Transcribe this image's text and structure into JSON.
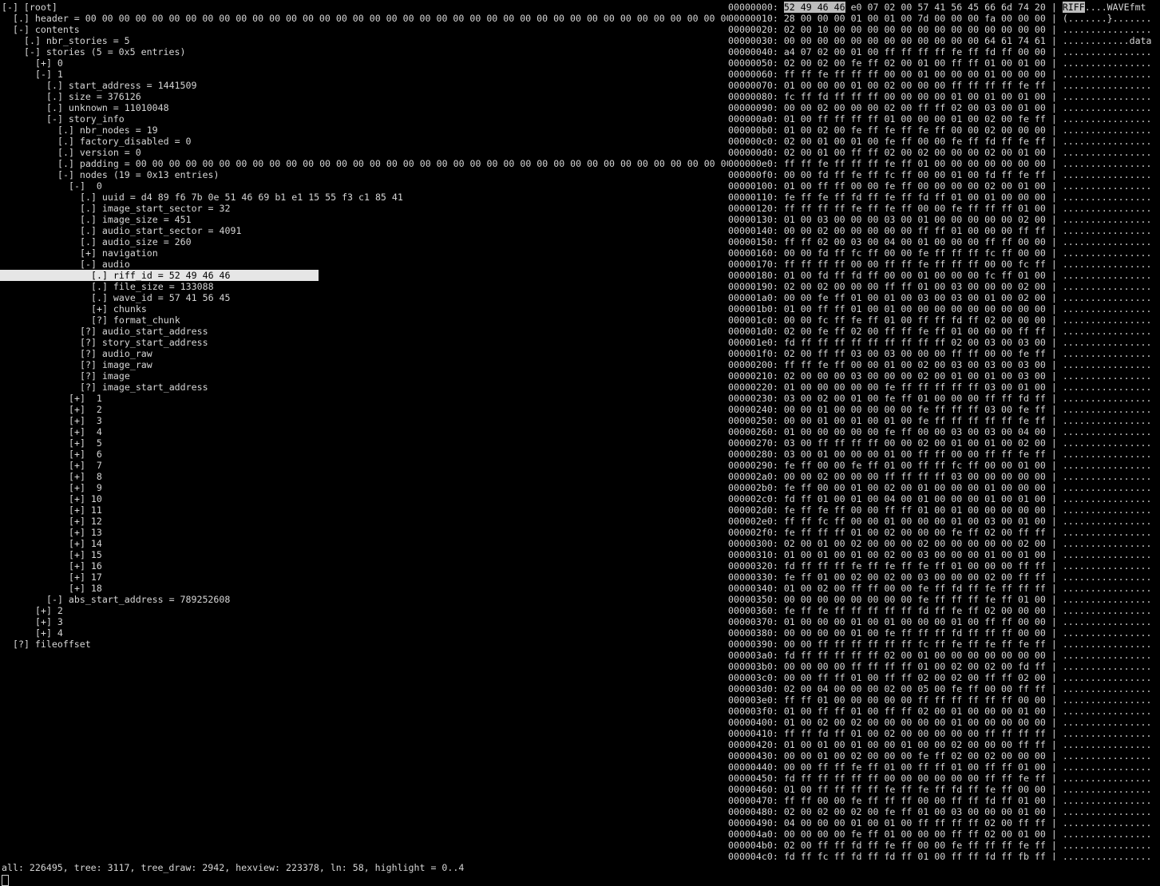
{
  "tree": {
    "selected_index": 24,
    "lines": [
      {
        "indent": 0,
        "marker": "[-]",
        "text": "[root]"
      },
      {
        "indent": 1,
        "marker": "[.]",
        "text": "header = 00 00 00 00 00 00 00 00 00 00 00 00 00 00 00 00 00 00 00 00 00 00 00 00 00 00 00 00 00 00 00 00 00 00 00 00 00 00 00 00 00 00 00 00 00 00 00 00 …"
      },
      {
        "indent": 1,
        "marker": "[-]",
        "text": "contents"
      },
      {
        "indent": 2,
        "marker": "[.]",
        "text": "nbr_stories = 5"
      },
      {
        "indent": 2,
        "marker": "[-]",
        "text": "stories (5 = 0x5 entries)"
      },
      {
        "indent": 3,
        "marker": "[+]",
        "text": "0"
      },
      {
        "indent": 3,
        "marker": "[-]",
        "text": "1"
      },
      {
        "indent": 4,
        "marker": "[.]",
        "text": "start_address = 1441509"
      },
      {
        "indent": 4,
        "marker": "[.]",
        "text": "size = 376126"
      },
      {
        "indent": 4,
        "marker": "[.]",
        "text": "unknown = 11010048"
      },
      {
        "indent": 4,
        "marker": "[-]",
        "text": "story_info"
      },
      {
        "indent": 5,
        "marker": "[.]",
        "text": "nbr_nodes = 19"
      },
      {
        "indent": 5,
        "marker": "[.]",
        "text": "factory_disabled = 0"
      },
      {
        "indent": 5,
        "marker": "[.]",
        "text": "version = 0"
      },
      {
        "indent": 5,
        "marker": "[.]",
        "text": "padding = 00 00 00 00 00 00 00 00 00 00 00 00 00 00 00 00 00 00 00 00 00 00 00 00 00 00 00 00 00 00 00 00 00 00 00 00 00 00 00 00 00 00 …"
      },
      {
        "indent": 5,
        "marker": "[-]",
        "text": "nodes (19 = 0x13 entries)"
      },
      {
        "indent": 6,
        "marker": "[-]",
        "text": " 0"
      },
      {
        "indent": 7,
        "marker": "[.]",
        "text": "uuid = d4 89 f6 7b 0e 51 46 69 b1 e1 15 55 f3 c1 85 41"
      },
      {
        "indent": 7,
        "marker": "[.]",
        "text": "image_start_sector = 32"
      },
      {
        "indent": 7,
        "marker": "[.]",
        "text": "image_size = 451"
      },
      {
        "indent": 7,
        "marker": "[.]",
        "text": "audio_start_sector = 4091"
      },
      {
        "indent": 7,
        "marker": "[.]",
        "text": "audio_size = 260"
      },
      {
        "indent": 7,
        "marker": "[+]",
        "text": "navigation"
      },
      {
        "indent": 7,
        "marker": "[-]",
        "text": "audio"
      },
      {
        "indent": 8,
        "marker": "[.]",
        "text": "riff_id = 52 49 46 46"
      },
      {
        "indent": 8,
        "marker": "[.]",
        "text": "file_size = 133088"
      },
      {
        "indent": 8,
        "marker": "[.]",
        "text": "wave_id = 57 41 56 45"
      },
      {
        "indent": 8,
        "marker": "[+]",
        "text": "chunks"
      },
      {
        "indent": 8,
        "marker": "[?]",
        "text": "format_chunk"
      },
      {
        "indent": 7,
        "marker": "[?]",
        "text": "audio_start_address"
      },
      {
        "indent": 7,
        "marker": "[?]",
        "text": "story_start_address"
      },
      {
        "indent": 7,
        "marker": "[?]",
        "text": "audio_raw"
      },
      {
        "indent": 7,
        "marker": "[?]",
        "text": "image_raw"
      },
      {
        "indent": 7,
        "marker": "[?]",
        "text": "image"
      },
      {
        "indent": 7,
        "marker": "[?]",
        "text": "image_start_address"
      },
      {
        "indent": 6,
        "marker": "[+]",
        "text": " 1"
      },
      {
        "indent": 6,
        "marker": "[+]",
        "text": " 2"
      },
      {
        "indent": 6,
        "marker": "[+]",
        "text": " 3"
      },
      {
        "indent": 6,
        "marker": "[+]",
        "text": " 4"
      },
      {
        "indent": 6,
        "marker": "[+]",
        "text": " 5"
      },
      {
        "indent": 6,
        "marker": "[+]",
        "text": " 6"
      },
      {
        "indent": 6,
        "marker": "[+]",
        "text": " 7"
      },
      {
        "indent": 6,
        "marker": "[+]",
        "text": " 8"
      },
      {
        "indent": 6,
        "marker": "[+]",
        "text": " 9"
      },
      {
        "indent": 6,
        "marker": "[+]",
        "text": "10"
      },
      {
        "indent": 6,
        "marker": "[+]",
        "text": "11"
      },
      {
        "indent": 6,
        "marker": "[+]",
        "text": "12"
      },
      {
        "indent": 6,
        "marker": "[+]",
        "text": "13"
      },
      {
        "indent": 6,
        "marker": "[+]",
        "text": "14"
      },
      {
        "indent": 6,
        "marker": "[+]",
        "text": "15"
      },
      {
        "indent": 6,
        "marker": "[+]",
        "text": "16"
      },
      {
        "indent": 6,
        "marker": "[+]",
        "text": "17"
      },
      {
        "indent": 6,
        "marker": "[+]",
        "text": "18"
      },
      {
        "indent": 4,
        "marker": "[-]",
        "text": "abs_start_address = 789252608"
      },
      {
        "indent": 3,
        "marker": "[+]",
        "text": "2"
      },
      {
        "indent": 3,
        "marker": "[+]",
        "text": "3"
      },
      {
        "indent": 3,
        "marker": "[+]",
        "text": "4"
      },
      {
        "indent": 1,
        "marker": "[?]",
        "text": "fileoffset"
      }
    ]
  },
  "hexview": {
    "highlight_row": 0,
    "highlight_bytes": [
      0,
      3
    ],
    "highlight_ascii": [
      0,
      3
    ],
    "rows": [
      {
        "addr": "00000000",
        "bytes": "52 49 46 46 e0 07 02 00 57 41 56 45 66 6d 74 20",
        "ascii": "RIFF....WAVEfmt "
      },
      {
        "addr": "00000010",
        "bytes": "28 00 00 00 01 00 01 00 7d 00 00 00 fa 00 00 00",
        "ascii": "(.......}......."
      },
      {
        "addr": "00000020",
        "bytes": "02 00 10 00 00 00 00 00 00 00 00 00 00 00 00 00",
        "ascii": "................"
      },
      {
        "addr": "00000030",
        "bytes": "00 00 00 00 00 00 00 00 00 00 00 00 64 61 74 61",
        "ascii": "............data"
      },
      {
        "addr": "00000040",
        "bytes": "a4 07 02 00 01 00 ff ff ff ff fe ff fd ff 00 00",
        "ascii": "................"
      },
      {
        "addr": "00000050",
        "bytes": "02 00 02 00 fe ff 02 00 01 00 ff ff 01 00 01 00",
        "ascii": "................"
      },
      {
        "addr": "00000060",
        "bytes": "ff ff fe ff ff ff 00 00 01 00 00 00 01 00 00 00",
        "ascii": "................"
      },
      {
        "addr": "00000070",
        "bytes": "01 00 00 00 01 00 02 00 00 00 ff ff ff ff fe ff",
        "ascii": "................"
      },
      {
        "addr": "00000080",
        "bytes": "fc ff fd ff ff ff 00 00 00 00 01 00 01 00 01 00",
        "ascii": "................"
      },
      {
        "addr": "00000090",
        "bytes": "00 00 02 00 00 00 02 00 ff ff 02 00 03 00 01 00",
        "ascii": "................"
      },
      {
        "addr": "000000a0",
        "bytes": "01 00 ff ff ff ff 01 00 00 00 01 00 02 00 fe ff",
        "ascii": "................"
      },
      {
        "addr": "000000b0",
        "bytes": "01 00 02 00 fe ff fe ff fe ff 00 00 02 00 00 00",
        "ascii": "................"
      },
      {
        "addr": "000000c0",
        "bytes": "02 00 01 00 01 00 fe ff 00 00 fe ff fd ff fe ff",
        "ascii": "................"
      },
      {
        "addr": "000000d0",
        "bytes": "02 00 01 00 ff ff 02 00 02 00 00 00 02 00 01 00",
        "ascii": "................"
      },
      {
        "addr": "000000e0",
        "bytes": "ff ff fe ff ff ff fe ff 01 00 00 00 00 00 00 00",
        "ascii": "................"
      },
      {
        "addr": "000000f0",
        "bytes": "00 00 fd ff fe ff fc ff 00 00 01 00 fd ff fe ff",
        "ascii": "................"
      },
      {
        "addr": "00000100",
        "bytes": "01 00 ff ff 00 00 fe ff 00 00 00 00 02 00 01 00",
        "ascii": "................"
      },
      {
        "addr": "00000110",
        "bytes": "fe ff fe ff fd ff fe ff fd ff 01 00 01 00 00 00",
        "ascii": "................"
      },
      {
        "addr": "00000120",
        "bytes": "ff ff ff ff fe ff fe ff 00 00 fe ff ff ff 01 00",
        "ascii": "................"
      },
      {
        "addr": "00000130",
        "bytes": "01 00 03 00 00 00 03 00 01 00 00 00 00 00 02 00",
        "ascii": "................"
      },
      {
        "addr": "00000140",
        "bytes": "00 00 02 00 00 00 00 00 ff ff 01 00 00 00 ff ff",
        "ascii": "................"
      },
      {
        "addr": "00000150",
        "bytes": "ff ff 02 00 03 00 04 00 01 00 00 00 ff ff 00 00",
        "ascii": "................"
      },
      {
        "addr": "00000160",
        "bytes": "00 00 fd ff fc ff 00 00 fe ff ff ff fc ff 00 00",
        "ascii": "................"
      },
      {
        "addr": "00000170",
        "bytes": "ff ff ff ff 00 00 ff ff fe ff ff ff 00 00 fc ff",
        "ascii": "................"
      },
      {
        "addr": "00000180",
        "bytes": "01 00 fd ff fd ff 00 00 01 00 00 00 fc ff 01 00",
        "ascii": "................"
      },
      {
        "addr": "00000190",
        "bytes": "02 00 02 00 00 00 ff ff 01 00 03 00 00 00 02 00",
        "ascii": "................"
      },
      {
        "addr": "000001a0",
        "bytes": "00 00 fe ff 01 00 01 00 03 00 03 00 01 00 02 00",
        "ascii": "................"
      },
      {
        "addr": "000001b0",
        "bytes": "01 00 ff ff 01 00 01 00 00 00 00 00 00 00 00 00",
        "ascii": "................"
      },
      {
        "addr": "000001c0",
        "bytes": "00 00 fc ff fe ff 01 00 ff ff fd ff 02 00 00 00",
        "ascii": "................"
      },
      {
        "addr": "000001d0",
        "bytes": "02 00 fe ff 02 00 ff ff fe ff 01 00 00 00 ff ff",
        "ascii": "................"
      },
      {
        "addr": "000001e0",
        "bytes": "fd ff ff ff ff ff ff ff ff ff 02 00 03 00 03 00",
        "ascii": "................"
      },
      {
        "addr": "000001f0",
        "bytes": "02 00 ff ff 03 00 03 00 00 00 ff ff 00 00 fe ff",
        "ascii": "................"
      },
      {
        "addr": "00000200",
        "bytes": "ff ff fe ff 00 00 01 00 02 00 03 00 03 00 03 00",
        "ascii": "................"
      },
      {
        "addr": "00000210",
        "bytes": "02 00 00 00 03 00 00 00 02 00 01 00 01 00 03 00",
        "ascii": "................"
      },
      {
        "addr": "00000220",
        "bytes": "01 00 00 00 00 00 fe ff ff ff ff ff 03 00 01 00",
        "ascii": "................"
      },
      {
        "addr": "00000230",
        "bytes": "03 00 02 00 01 00 fe ff 01 00 00 00 ff ff fd ff",
        "ascii": "................"
      },
      {
        "addr": "00000240",
        "bytes": "00 00 01 00 00 00 00 00 fe ff ff ff 03 00 fe ff",
        "ascii": "................"
      },
      {
        "addr": "00000250",
        "bytes": "00 00 01 00 01 00 01 00 fe ff ff ff ff ff fe ff",
        "ascii": "................"
      },
      {
        "addr": "00000260",
        "bytes": "01 00 00 00 00 00 fe ff 00 00 03 00 03 00 04 00",
        "ascii": "................"
      },
      {
        "addr": "00000270",
        "bytes": "03 00 ff ff ff ff 00 00 02 00 01 00 01 00 02 00",
        "ascii": "................"
      },
      {
        "addr": "00000280",
        "bytes": "03 00 01 00 00 00 01 00 ff ff 00 00 ff ff fe ff",
        "ascii": "................"
      },
      {
        "addr": "00000290",
        "bytes": "fe ff 00 00 fe ff 01 00 ff ff fc ff 00 00 01 00",
        "ascii": "................"
      },
      {
        "addr": "000002a0",
        "bytes": "00 00 02 00 00 00 ff ff ff ff 03 00 00 00 00 00",
        "ascii": "................"
      },
      {
        "addr": "000002b0",
        "bytes": "fe ff 00 00 01 00 02 00 01 00 00 00 01 00 00 00",
        "ascii": "................"
      },
      {
        "addr": "000002c0",
        "bytes": "fd ff 01 00 01 00 04 00 01 00 00 00 01 00 01 00",
        "ascii": "................"
      },
      {
        "addr": "000002d0",
        "bytes": "fe ff fe ff 00 00 ff ff 01 00 01 00 00 00 00 00",
        "ascii": "................"
      },
      {
        "addr": "000002e0",
        "bytes": "ff ff fc ff 00 00 01 00 00 00 01 00 03 00 01 00",
        "ascii": "................"
      },
      {
        "addr": "000002f0",
        "bytes": "fe ff ff ff 01 00 02 00 00 00 fe ff 02 00 ff ff",
        "ascii": "................"
      },
      {
        "addr": "00000300",
        "bytes": "02 00 01 00 02 00 00 00 02 00 00 00 00 00 02 00",
        "ascii": "................"
      },
      {
        "addr": "00000310",
        "bytes": "01 00 01 00 01 00 02 00 03 00 00 00 01 00 01 00",
        "ascii": "................"
      },
      {
        "addr": "00000320",
        "bytes": "fd ff ff ff fe ff fe ff fe ff 01 00 00 00 ff ff",
        "ascii": "................"
      },
      {
        "addr": "00000330",
        "bytes": "fe ff 01 00 02 00 02 00 03 00 00 00 02 00 ff ff",
        "ascii": "................"
      },
      {
        "addr": "00000340",
        "bytes": "01 00 02 00 ff ff 00 00 fe ff fd ff fe ff ff ff",
        "ascii": "................"
      },
      {
        "addr": "00000350",
        "bytes": "00 00 00 00 00 00 00 00 fe ff ff ff fe ff 01 00",
        "ascii": "................"
      },
      {
        "addr": "00000360",
        "bytes": "fe ff fe ff ff ff ff ff fd ff fe ff 02 00 00 00",
        "ascii": "................"
      },
      {
        "addr": "00000370",
        "bytes": "01 00 00 00 01 00 01 00 00 00 01 00 ff ff 00 00",
        "ascii": "................"
      },
      {
        "addr": "00000380",
        "bytes": "00 00 00 00 01 00 fe ff ff ff fd ff ff ff 00 00",
        "ascii": "................"
      },
      {
        "addr": "00000390",
        "bytes": "00 00 ff ff ff ff ff ff fc ff fe ff fe ff fe ff",
        "ascii": "................"
      },
      {
        "addr": "000003a0",
        "bytes": "fd ff ff ff ff ff 02 00 01 00 00 00 00 00 00 00",
        "ascii": "................"
      },
      {
        "addr": "000003b0",
        "bytes": "00 00 00 00 ff ff ff ff 01 00 02 00 02 00 fd ff",
        "ascii": "................"
      },
      {
        "addr": "000003c0",
        "bytes": "00 00 ff ff 01 00 ff ff 02 00 02 00 ff ff 02 00",
        "ascii": "................"
      },
      {
        "addr": "000003d0",
        "bytes": "02 00 04 00 00 00 02 00 05 00 fe ff 00 00 ff ff",
        "ascii": "................"
      },
      {
        "addr": "000003e0",
        "bytes": "ff ff 01 00 00 00 00 00 ff ff ff ff ff ff 00 00",
        "ascii": "................"
      },
      {
        "addr": "000003f0",
        "bytes": "01 00 ff ff 01 00 ff ff 02 00 01 00 00 00 01 00",
        "ascii": "................"
      },
      {
        "addr": "00000400",
        "bytes": "01 00 02 00 02 00 00 00 00 00 01 00 00 00 00 00",
        "ascii": "................"
      },
      {
        "addr": "00000410",
        "bytes": "ff ff fd ff 01 00 02 00 00 00 00 00 ff ff ff ff",
        "ascii": "................"
      },
      {
        "addr": "00000420",
        "bytes": "01 00 01 00 01 00 00 01 00 00 02 00 00 00 ff ff",
        "ascii": "................"
      },
      {
        "addr": "00000430",
        "bytes": "00 00 01 00 02 00 00 00 fe ff 02 00 02 00 00 00",
        "ascii": "................"
      },
      {
        "addr": "00000440",
        "bytes": "00 00 ff ff fe ff 01 00 ff ff 01 00 ff ff 01 00",
        "ascii": "................"
      },
      {
        "addr": "00000450",
        "bytes": "fd ff ff ff ff ff 00 00 00 00 00 00 ff ff fe ff",
        "ascii": "................"
      },
      {
        "addr": "00000460",
        "bytes": "01 00 ff ff ff ff fe ff fe ff fd ff fe ff 00 00",
        "ascii": "................"
      },
      {
        "addr": "00000470",
        "bytes": "ff ff 00 00 fe ff ff ff 00 00 ff ff fd ff 01 00",
        "ascii": "................"
      },
      {
        "addr": "00000480",
        "bytes": "02 00 02 00 02 00 fe ff 01 00 03 00 00 00 01 00",
        "ascii": "................"
      },
      {
        "addr": "00000490",
        "bytes": "04 00 00 00 01 00 01 00 ff ff ff ff 02 00 ff ff",
        "ascii": "................"
      },
      {
        "addr": "000004a0",
        "bytes": "00 00 00 00 fe ff 01 00 00 00 ff ff 02 00 01 00",
        "ascii": "................"
      },
      {
        "addr": "000004b0",
        "bytes": "02 00 ff ff fd ff fe ff 00 00 fe ff ff ff fe ff",
        "ascii": "................"
      },
      {
        "addr": "000004c0",
        "bytes": "fd ff fc ff fd ff fd ff 01 00 ff ff fd ff fb ff",
        "ascii": "................"
      }
    ]
  },
  "status": {
    "text": "all: 226495, tree: 3117, tree_draw: 2942, hexview: 223378, ln: 58, highlight = 0..4"
  }
}
